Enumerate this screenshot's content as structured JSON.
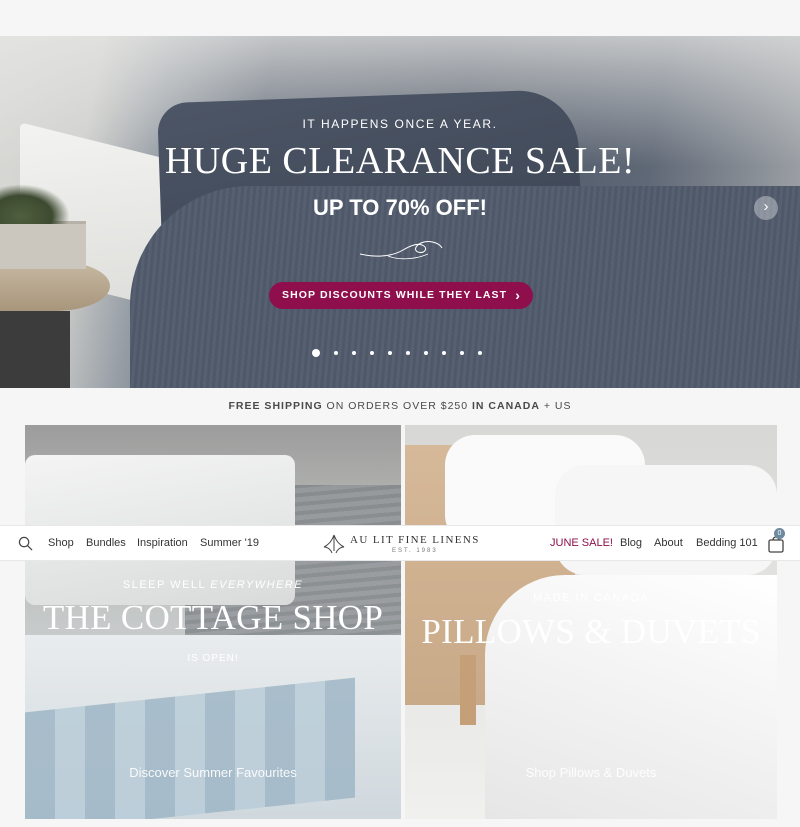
{
  "hero": {
    "eyebrow": "IT HAPPENS ONCE A YEAR.",
    "headline": "HUGE CLEARANCE SALE!",
    "subhead": "UP TO 70% OFF!",
    "cta_label": "SHOP DISCOUNTS WHILE THEY LAST",
    "next_icon": "chevron-right-icon",
    "slide_count": 10,
    "active_slide": 1
  },
  "shipping_bar": {
    "part1": "FREE SHIPPING",
    "part2": " ON ORDERS OVER $250 ",
    "part3": "IN CANADA",
    "part4": " + US"
  },
  "nav": {
    "search_icon": "search-icon",
    "items_left": [
      "Shop",
      "Bundles",
      "Inspiration",
      "Summer '19"
    ],
    "logo_text": "AU LIT FINE LINENS",
    "logo_est": "EST. 1983",
    "sale_label": "JUNE SALE!",
    "items_right": [
      "Blog",
      "About",
      "Bedding 101"
    ],
    "cart_icon": "shopping-bag-icon",
    "cart_count": "0"
  },
  "tiles": [
    {
      "kicker_pre": "SLEEP WELL ",
      "kicker_em": "EVERYWHERE",
      "title": "THE COTTAGE SHOP",
      "subtitle": "IS OPEN!",
      "link": "Discover Summer Favourites"
    },
    {
      "kicker": "MADE IN CANADA",
      "title": "PILLOWS & DUVETS",
      "link": "Shop Pillows & Duvets"
    }
  ],
  "colors": {
    "accent": "#8e0f4c",
    "badge": "#6d8aa0"
  }
}
